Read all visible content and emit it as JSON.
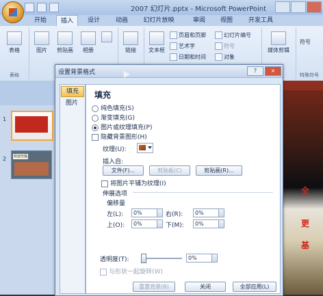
{
  "window": {
    "title": "2007 幻灯片.pptx - Microsoft PowerPoint"
  },
  "tabs": [
    "开始",
    "插入",
    "设计",
    "动画",
    "幻灯片放映",
    "审阅",
    "视图",
    "开发工具"
  ],
  "active_tab": "插入",
  "ribbon": {
    "table": "表格",
    "table_group": "表格",
    "picture": "图片",
    "clipart": "剪贴画",
    "album": "相册",
    "link": "链接",
    "textbox": "文本框",
    "header_footer": "页眉和页脚",
    "wordart": "艺术字",
    "symbol1": "符号",
    "slide_number": "幻灯片编号",
    "datetime": "日期和时间",
    "object": "对象",
    "media_clip": "媒体剪辑",
    "symbol2": "符号",
    "special_symbol": "特殊符号"
  },
  "dialog": {
    "title": "设置背景格式",
    "help": "?",
    "close": "×",
    "nav": [
      "填充",
      "图片"
    ],
    "section_title": "填充",
    "radios": [
      {
        "label": "纯色填充(S)",
        "checked": false
      },
      {
        "label": "渐变填充(G)",
        "checked": false
      },
      {
        "label": "图片或纹理填充(P)",
        "checked": true
      }
    ],
    "hide_bg": "隐藏背景图形(H)",
    "texture_label": "纹理(U):",
    "insert_from": "插入自:",
    "file_btn": "文件(F)...",
    "clipboard_btn": "剪贴板(C)",
    "clipart_btn": "剪贴画(R)...",
    "tile": "将图片平铺为纹理(I)",
    "stretch_options": "伸展选项",
    "offsets": "偏移量",
    "left_label": "左(L):",
    "left_val": "0%",
    "right_label": "右(R):",
    "right_val": "0%",
    "top_label": "上(O):",
    "top_val": "0%",
    "bottom_label": "下(M):",
    "bottom_val": "0%",
    "transparency_label": "透明度(T):",
    "transparency_val": "0%",
    "transparency_level": 0,
    "rotate_with_shape": "与形状一起旋转(W)",
    "reset_btn": "重置背景(B)",
    "close_btn": "关闭",
    "apply_all_btn": "全部应用(L)"
  },
  "slides": {
    "numbers": [
      "1",
      "2"
    ],
    "thumb2_caption": "欢迎光临"
  },
  "slide_right_text": [
    "全",
    "更",
    "基"
  ]
}
